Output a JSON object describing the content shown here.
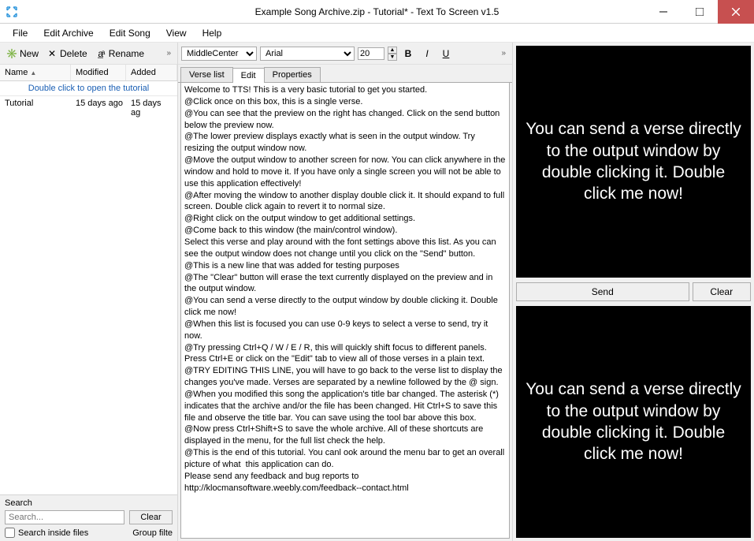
{
  "window": {
    "title": "Example Song Archive.zip - Tutorial* - Text To Screen v1.5"
  },
  "menu": {
    "file": "File",
    "edit_archive": "Edit Archive",
    "edit_song": "Edit Song",
    "view": "View",
    "help": "Help"
  },
  "left_toolbar": {
    "new": "New",
    "delete": "Delete",
    "rename": "Rename"
  },
  "list": {
    "columns": {
      "name": "Name",
      "modified": "Modified",
      "added": "Added"
    },
    "hint": "Double click to open the tutorial",
    "rows": [
      {
        "name": "Tutorial",
        "modified": "15 days ago",
        "added": "15 days ag"
      }
    ]
  },
  "search": {
    "label": "Search",
    "placeholder": "Search...",
    "clear": "Clear",
    "inside_files": "Search inside files",
    "group_filter": "Group filte"
  },
  "mid_toolbar": {
    "align_value": "MiddleCenter",
    "font_value": "Arial",
    "size_value": "20",
    "bold": "B",
    "italic": "I",
    "underline": "U"
  },
  "tabs": {
    "verse_list": "Verse list",
    "edit": "Edit",
    "properties": "Properties"
  },
  "editor_text": "Welcome to TTS! This is a very basic tutorial to get you started.\n@Click once on this box, this is a single verse.\n@You can see that the preview on the right has changed. Click on the send button below the preview now.\n@The lower preview displays exactly what is seen in the output window. Try resizing the output window now.\n@Move the output window to another screen for now. You can click anywhere in the window and hold to move it. If you have only a single screen you will not be able to use this application effectively!\n@After moving the window to another display double click it. It should expand to full screen. Double click again to revert it to normal size.\n@Right click on the output window to get additional settings.\n@Come back to this window (the main/control window).\nSelect this verse and play around with the font settings above this list. As you can see the output window does not change until you click on the \"Send\" button.\n@This is a new line that was added for testing purposes\n@The \"Clear\" button will erase the text currently displayed on the preview and in the output window.\n@You can send a verse directly to the output window by double clicking it. Double click me now!\n@When this list is focused you can use 0-9 keys to select a verse to send, try it now.\n@Try pressing Ctrl+Q / W / E / R, this will quickly shift focus to different panels. Press Ctrl+E or click on the \"Edit\" tab to view all of those verses in a plain text.\n@TRY EDITING THIS LINE, you will have to go back to the verse list to display the changes you've made. Verses are separated by a newline followed by the @ sign.\n@When you modified this song the application's title bar changed. The asterisk (*) indicates that the archive and/or the file has been changed. Hit Ctrl+S to save this file and observe the title bar. You can save using the tool bar above this box.\n@Now press Ctrl+Shift+S to save the whole archive. All of these shortcuts are displayed in the menu, for the full list check the help.\n@This is the end of this tutorial. You canl ook around the menu bar to get an overall picture of what  this application can do.\nPlease send any feedback and bug reports to http://klocmansoftware.weebly.com/feedback--contact.html",
  "preview_text": "You can send a verse directly to the output window by double clicking it. Double click me now!",
  "right_buttons": {
    "send": "Send",
    "clear": "Clear"
  }
}
